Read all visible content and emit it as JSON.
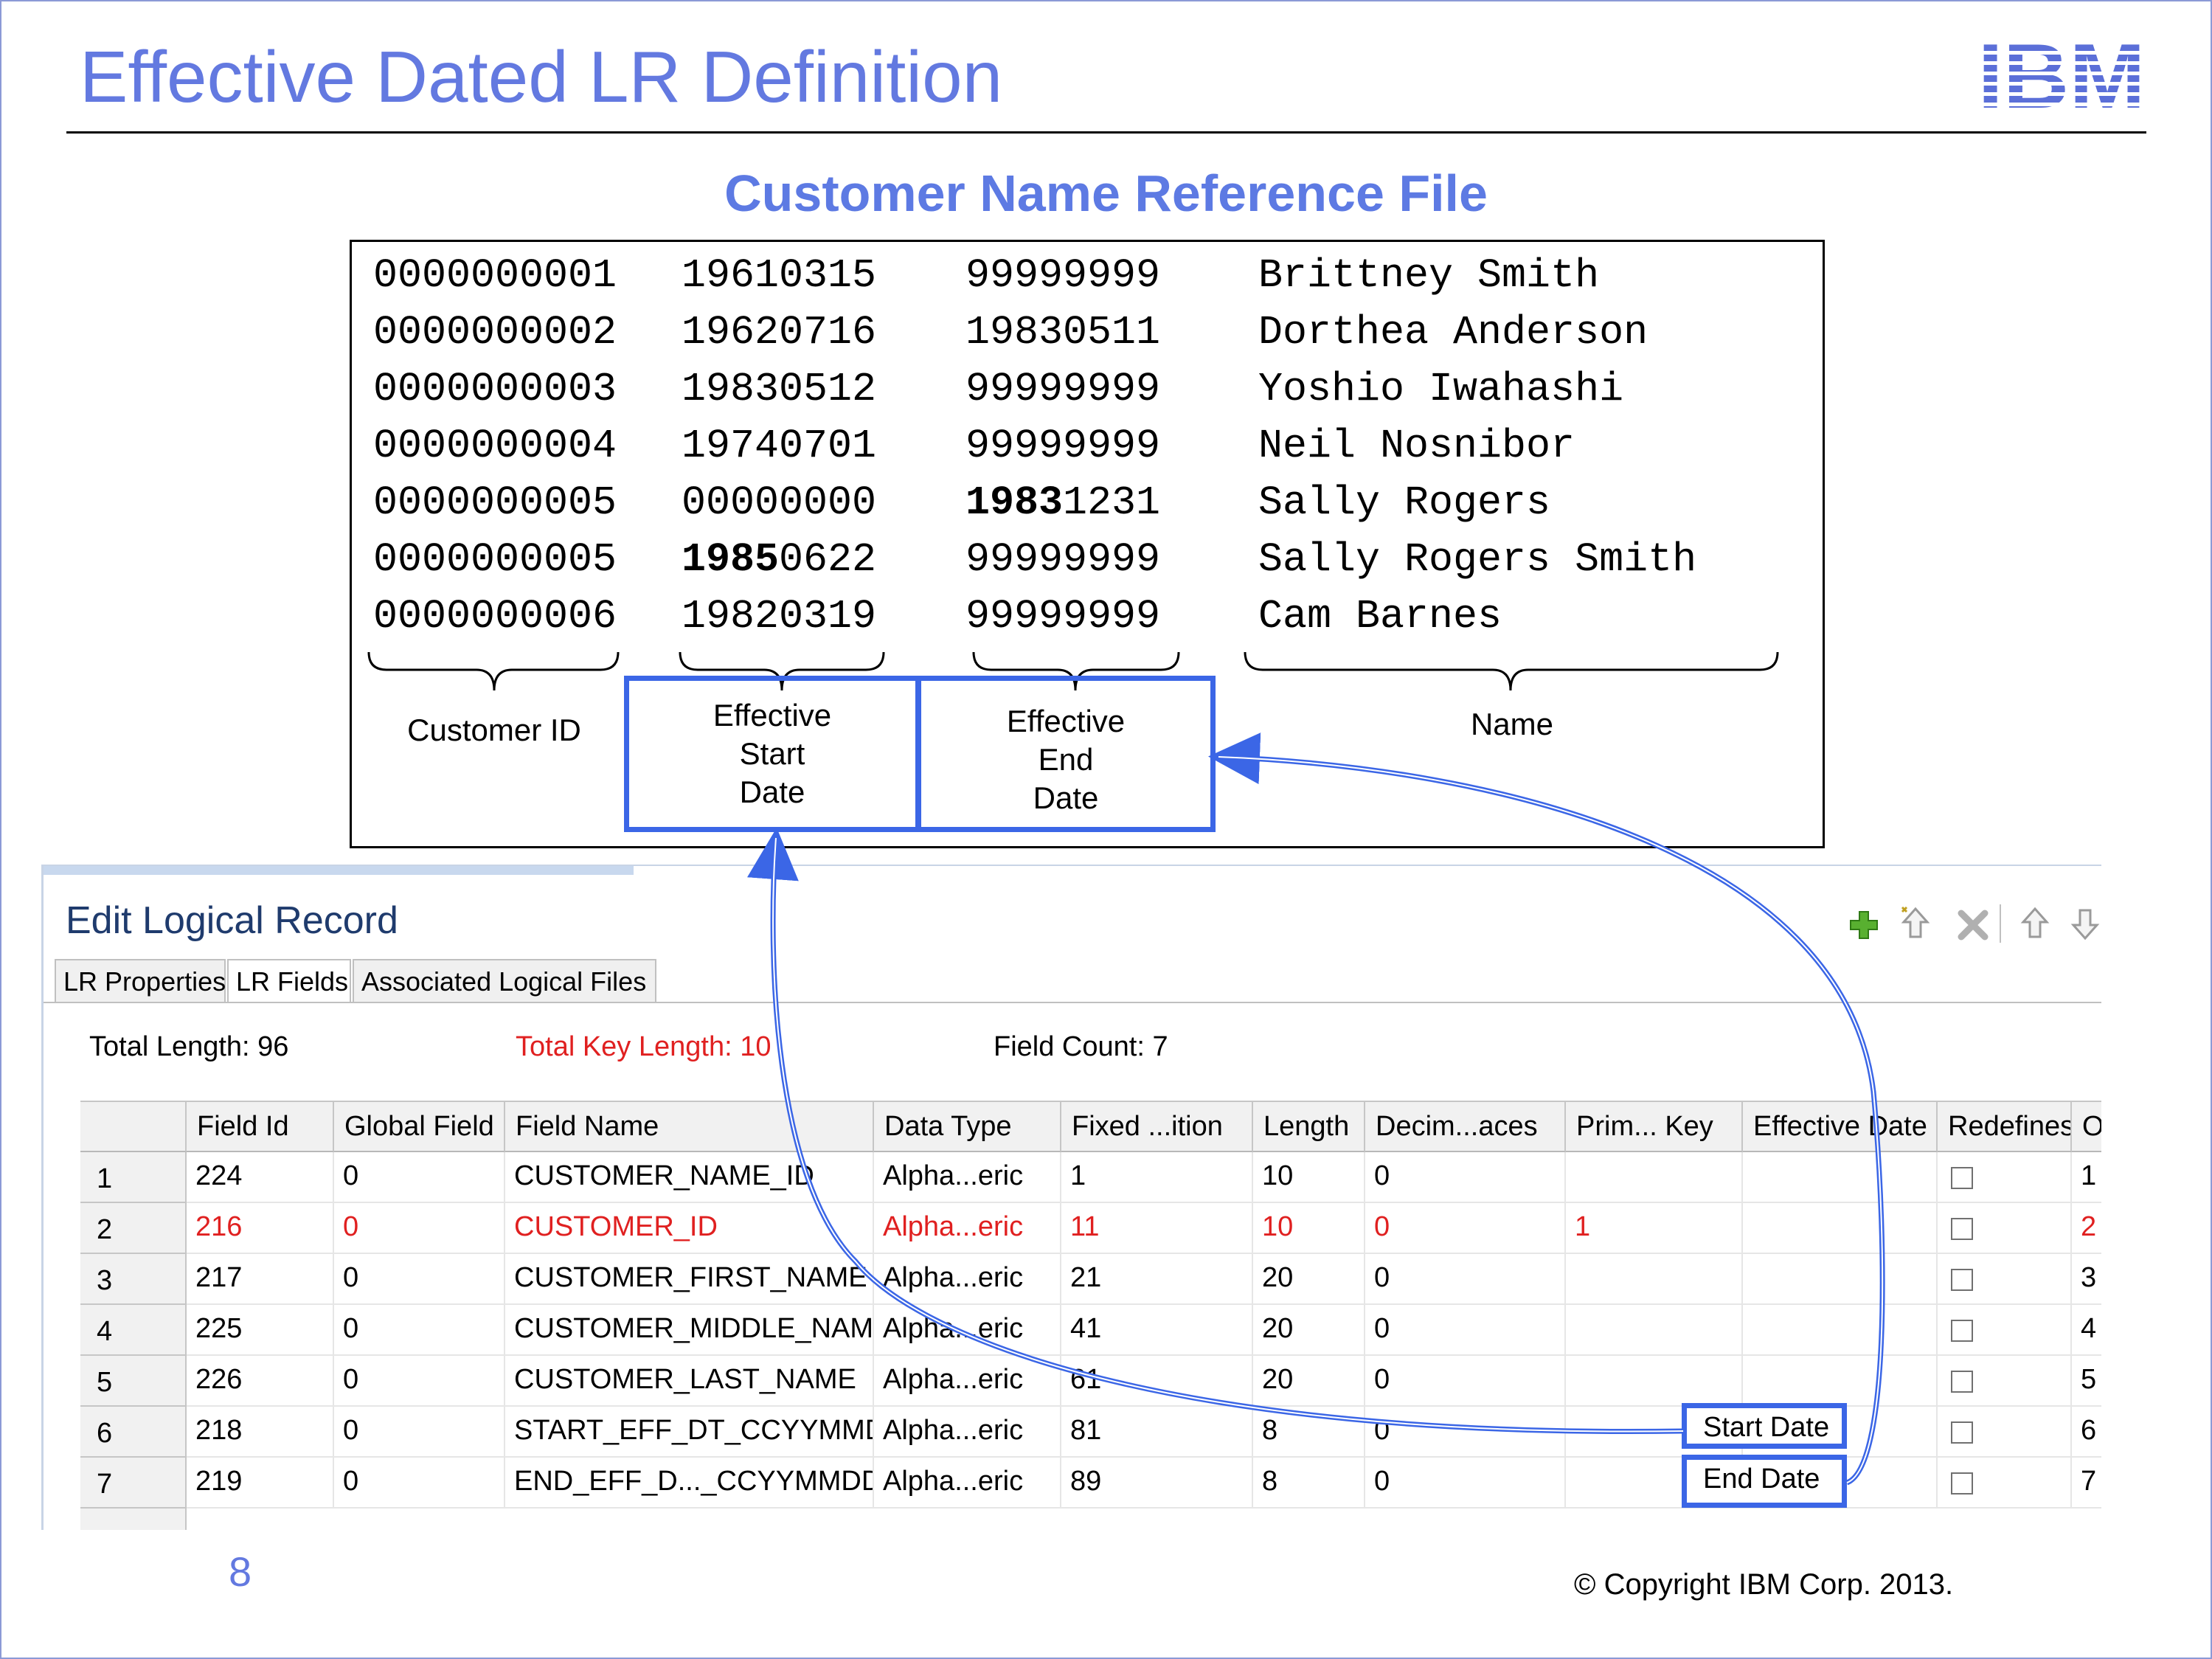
{
  "slide": {
    "title": "Effective Dated LR Definition",
    "section_title": "Customer Name Reference File",
    "page_number": "8",
    "copyright": "© Copyright IBM Corp. 2013.",
    "logo_text": "IBM",
    "accent_color": "#3b66e6",
    "title_color": "#6379e0"
  },
  "reference_file": {
    "rows": [
      {
        "id": "0000000001",
        "start": "19610315",
        "end": "99999999",
        "name": "Brittney Smith"
      },
      {
        "id": "0000000002",
        "start": "19620716",
        "end": "19830511",
        "name": "Dorthea Anderson"
      },
      {
        "id": "0000000003",
        "start": "19830512",
        "end": "99999999",
        "name": "Yoshio Iwahashi"
      },
      {
        "id": "0000000004",
        "start": "19740701",
        "end": "99999999",
        "name": "Neil Nosnibor"
      },
      {
        "id": "0000000005",
        "start": "00000000",
        "end_bold": "1983",
        "end_rest": "1231",
        "name": "Sally Rogers"
      },
      {
        "id": "0000000005",
        "start_bold": "1985",
        "start_rest": "0622",
        "end": "99999999",
        "name": "Sally Rogers Smith"
      },
      {
        "id": "0000000006",
        "start": "19820319",
        "end": "99999999",
        "name": "Cam Barnes"
      }
    ],
    "labels": {
      "customer_id": "Customer ID",
      "start": [
        "Effective",
        "Start",
        "Date"
      ],
      "end": [
        "Effective",
        "End",
        "Date"
      ],
      "name": "Name"
    }
  },
  "editor": {
    "title": "Edit Logical Record",
    "toolbar": [
      "add-icon",
      "insert-icon",
      "delete-icon",
      "move-up-icon",
      "move-down-icon"
    ],
    "tabs": [
      {
        "label": "LR Properties",
        "active": false
      },
      {
        "label": "LR Fields",
        "active": true
      },
      {
        "label": "Associated Logical Files",
        "active": false
      }
    ],
    "summary": {
      "total_length": "Total Length: 96",
      "total_key_length": "Total Key Length: 10",
      "field_count": "Field Count: 7"
    },
    "columns": [
      "Field Id",
      "Global Field",
      "Field Name",
      "Data Type",
      "Fixed ...ition",
      "Length",
      "Decim...aces",
      "Prim... Key",
      "Effective Date",
      "Redefines",
      "Ord"
    ],
    "rows": [
      {
        "num": "1",
        "field_id": "224",
        "global": "0",
        "name": "CUSTOMER_NAME_ID",
        "type": "Alpha...eric",
        "pos": "1",
        "length": "10",
        "decimals": "0",
        "key": "",
        "eff": "",
        "ord": "1",
        "highlight": false
      },
      {
        "num": "2",
        "field_id": "216",
        "global": "0",
        "name": "CUSTOMER_ID",
        "type": "Alpha...eric",
        "pos": "11",
        "length": "10",
        "decimals": "0",
        "key": "1",
        "eff": "",
        "ord": "2",
        "highlight": true
      },
      {
        "num": "3",
        "field_id": "217",
        "global": "0",
        "name": "CUSTOMER_FIRST_NAME",
        "type": "Alpha...eric",
        "pos": "21",
        "length": "20",
        "decimals": "0",
        "key": "",
        "eff": "",
        "ord": "3",
        "highlight": false
      },
      {
        "num": "4",
        "field_id": "225",
        "global": "0",
        "name": "CUSTOMER_MIDDLE_NAME",
        "type": "Alpha...eric",
        "pos": "41",
        "length": "20",
        "decimals": "0",
        "key": "",
        "eff": "",
        "ord": "4",
        "highlight": false
      },
      {
        "num": "5",
        "field_id": "226",
        "global": "0",
        "name": "CUSTOMER_LAST_NAME",
        "type": "Alpha...eric",
        "pos": "61",
        "length": "20",
        "decimals": "0",
        "key": "",
        "eff": "",
        "ord": "5",
        "highlight": false
      },
      {
        "num": "6",
        "field_id": "218",
        "global": "0",
        "name": "START_EFF_DT_CCYYMMDD",
        "type": "Alpha...eric",
        "pos": "81",
        "length": "8",
        "decimals": "0",
        "key": "",
        "eff": "Start Date",
        "ord": "6",
        "highlight": false
      },
      {
        "num": "7",
        "field_id": "219",
        "global": "0",
        "name": "END_EFF_D..._CCYYMMDD",
        "type": "Alpha...eric",
        "pos": "89",
        "length": "8",
        "decimals": "0",
        "key": "",
        "eff": "End Date",
        "ord": "7",
        "highlight": false
      }
    ]
  }
}
